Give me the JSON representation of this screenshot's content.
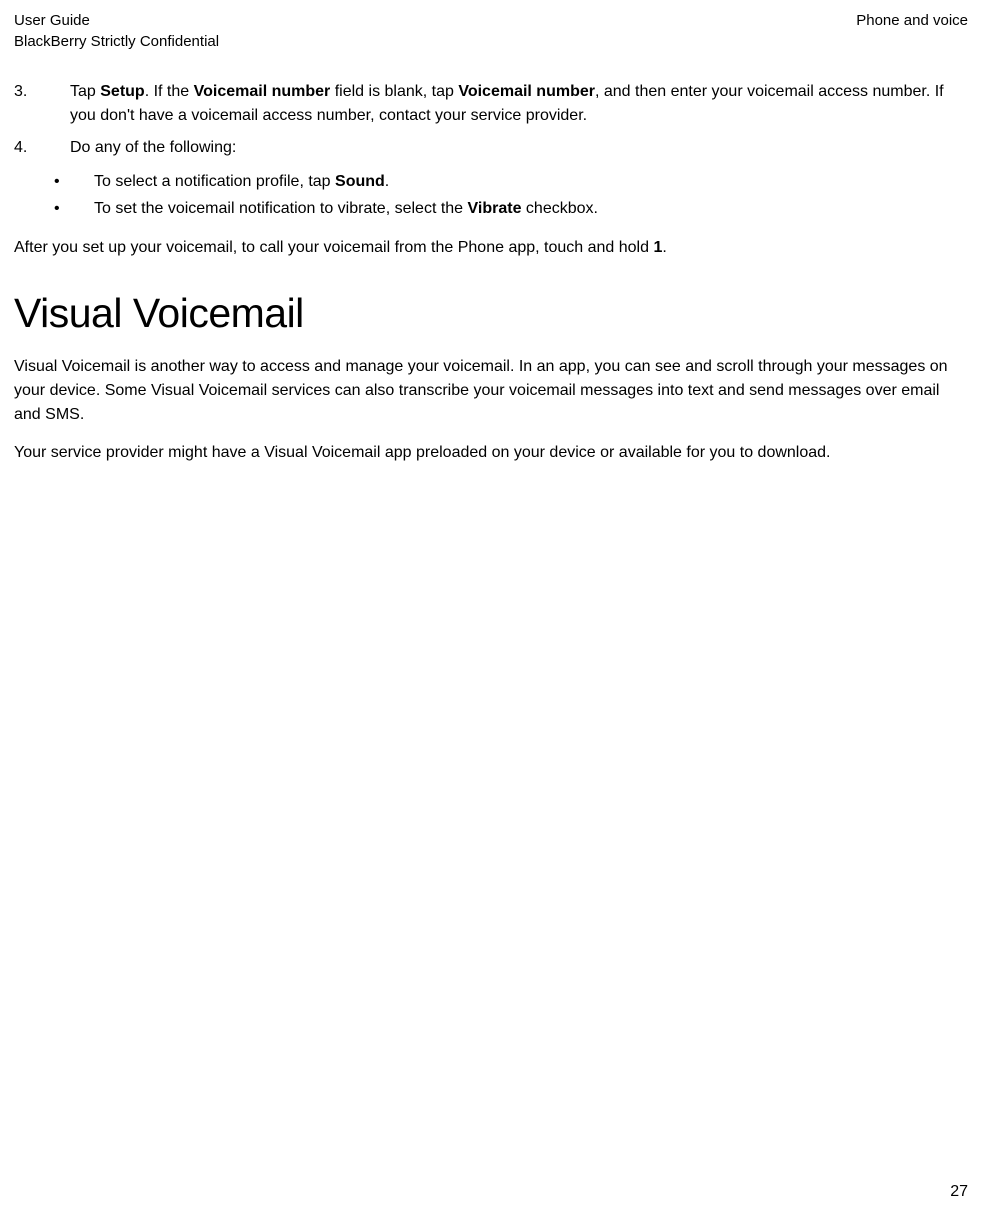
{
  "header": {
    "left_line1": "User Guide",
    "left_line2": "BlackBerry Strictly Confidential",
    "right_line1": "Phone and voice"
  },
  "step3": {
    "num": "3.",
    "t1": "Tap ",
    "b1": "Setup",
    "t2": ". If the ",
    "b2": "Voicemail number",
    "t3": " field is blank, tap ",
    "b3": "Voicemail number",
    "t4": ", and then enter your voicemail access number. If you don't have a voicemail access number, contact your service provider."
  },
  "step4": {
    "num": "4.",
    "t1": "Do any of the following:"
  },
  "bullet1": {
    "dot": "•",
    "t1": "To select a notification profile, tap ",
    "b1": "Sound",
    "t2": "."
  },
  "bullet2": {
    "dot": "•",
    "t1": "To set the voicemail notification to vibrate, select the ",
    "b1": "Vibrate",
    "t2": " checkbox."
  },
  "after_para": {
    "t1": "After you set up your voicemail, to call your voicemail from the Phone app, touch and hold ",
    "b1": "1",
    "t2": "."
  },
  "section_title": "Visual Voicemail",
  "vv_para1": "Visual Voicemail is another way to access and manage your voicemail. In an app, you can see and scroll through your messages on your device. Some Visual Voicemail services can also transcribe your voicemail messages into text and send messages over email and SMS.",
  "vv_para2": "Your service provider might have a Visual Voicemail app preloaded on your device or available for you to download.",
  "page_number": "27"
}
